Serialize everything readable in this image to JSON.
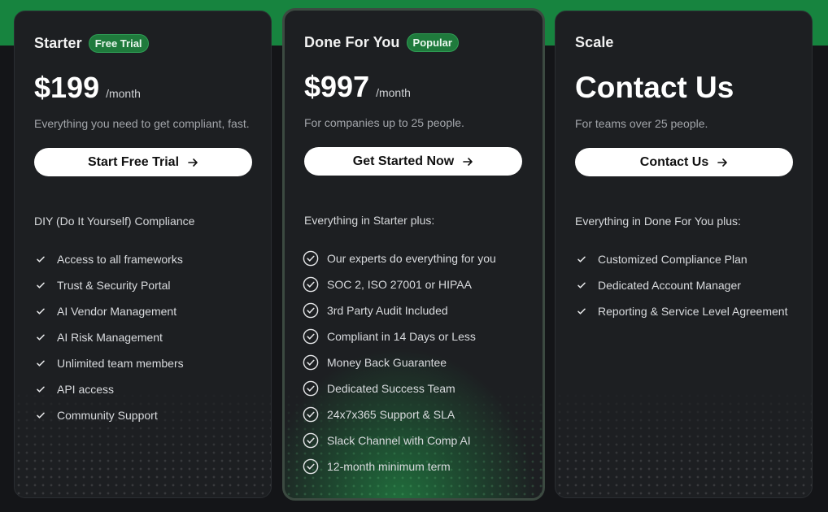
{
  "colors": {
    "accent": "#17843f",
    "badge": "#1f7a3c",
    "card": "#1d1f22",
    "background": "#141518"
  },
  "plans": [
    {
      "name": "Starter",
      "badge": "Free Trial",
      "price": "$199",
      "period": "/month",
      "description": "Everything you need to get compliant, fast.",
      "cta": "Start Free Trial",
      "section_label": "DIY (Do It Yourself) Compliance",
      "check_icon": "check-icon",
      "features": [
        "Access to all frameworks",
        "Trust & Security Portal",
        "AI Vendor Management",
        "AI Risk Management",
        "Unlimited team members",
        "API access",
        "Community Support"
      ]
    },
    {
      "name": "Done For You",
      "badge": "Popular",
      "price": "$997",
      "period": "/month",
      "description": "For companies up to 25 people.",
      "cta": "Get Started Now",
      "section_label": "Everything in Starter plus:",
      "check_icon": "check-circle-icon",
      "features": [
        "Our experts do everything for you",
        "SOC 2, ISO 27001 or HIPAA",
        "3rd Party Audit Included",
        "Compliant in 14 Days or Less",
        "Money Back Guarantee",
        "Dedicated Success Team",
        "24x7x365 Support & SLA",
        "Slack Channel with Comp AI",
        "12-month minimum term"
      ]
    },
    {
      "name": "Scale",
      "price": "Contact Us",
      "description": "For teams over 25 people.",
      "cta": "Contact Us",
      "section_label": "Everything in Done For You plus:",
      "check_icon": "check-icon",
      "features": [
        "Customized Compliance Plan",
        "Dedicated Account Manager",
        "Reporting & Service Level Agreement"
      ]
    }
  ]
}
